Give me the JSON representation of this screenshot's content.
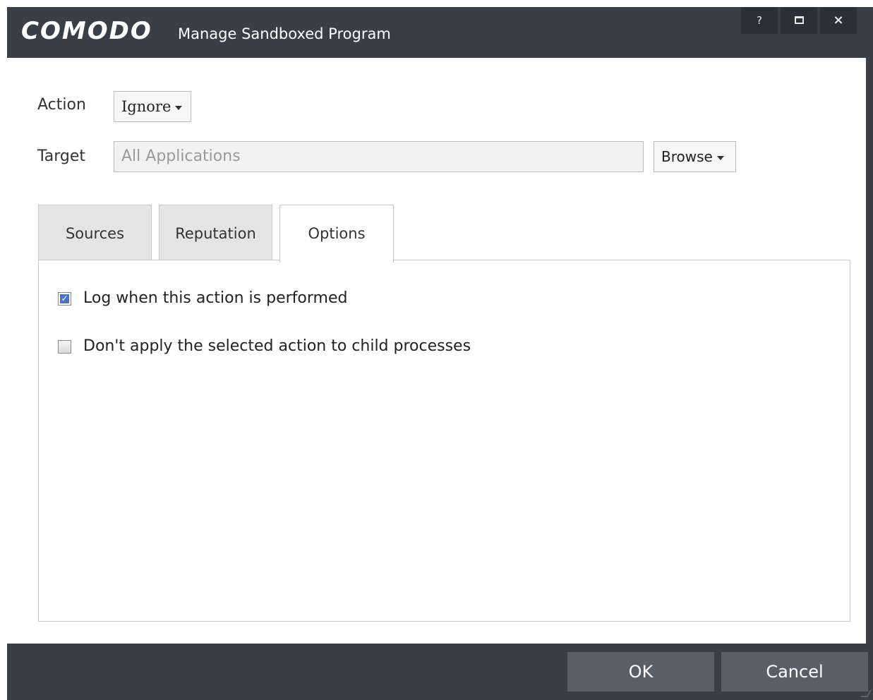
{
  "window": {
    "brand": "COMODO",
    "title": "Manage Sandboxed Program",
    "help_label": "?",
    "close_label": "×"
  },
  "form": {
    "action_label": "Action",
    "action_value": "Ignore",
    "target_label": "Target",
    "target_placeholder": "All Applications",
    "browse_label": "Browse"
  },
  "tabs": [
    {
      "label": "Sources",
      "active": false
    },
    {
      "label": "Reputation",
      "active": false
    },
    {
      "label": "Options",
      "active": true
    }
  ],
  "options": [
    {
      "label": "Log when this action is performed",
      "checked": true
    },
    {
      "label": "Don't apply the selected action to child processes",
      "checked": false
    }
  ],
  "footer": {
    "ok_label": "OK",
    "cancel_label": "Cancel"
  },
  "colors": {
    "frame": "#3a3e45",
    "button": "#5a5f66",
    "checkbox_accent": "#4a72c8"
  }
}
